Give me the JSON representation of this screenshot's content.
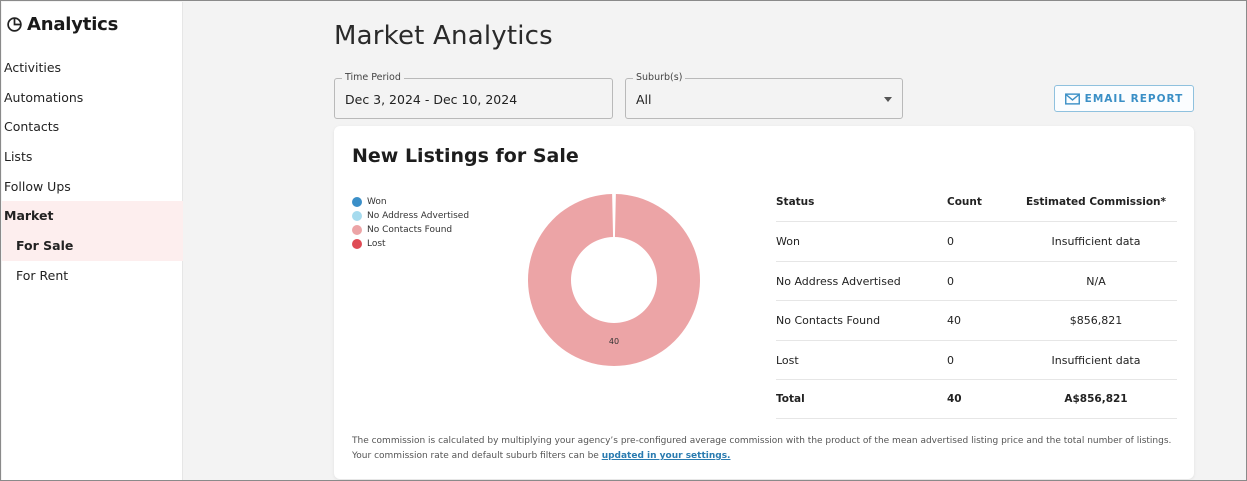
{
  "app": {
    "title": "Analytics"
  },
  "sidebar": {
    "items": [
      {
        "label": "Activities"
      },
      {
        "label": "Automations"
      },
      {
        "label": "Contacts"
      },
      {
        "label": "Lists"
      },
      {
        "label": "Follow Ups"
      },
      {
        "label": "Market"
      }
    ],
    "subitems": [
      {
        "label": "For Sale"
      },
      {
        "label": "For Rent"
      }
    ]
  },
  "main": {
    "title": "Market Analytics",
    "time_period": {
      "legend": "Time Period",
      "value": "Dec 3, 2024 - Dec 10, 2024"
    },
    "suburbs": {
      "legend": "Suburb(s)",
      "value": "All"
    },
    "email_button": "EMAIL REPORT"
  },
  "card": {
    "title": "New Listings for Sale",
    "legend": [
      {
        "label": "Won",
        "color": "#3b8fc8"
      },
      {
        "label": "No Address Advertised",
        "color": "#a6dbee"
      },
      {
        "label": "No Contacts Found",
        "color": "#eca4a6"
      },
      {
        "label": "Lost",
        "color": "#df4b55"
      }
    ],
    "table": {
      "headers": [
        "Status",
        "Count",
        "Estimated Commission*"
      ],
      "rows": [
        [
          "Won",
          "0",
          "Insufficient data"
        ],
        [
          "No Address Advertised",
          "0",
          "N/A"
        ],
        [
          "No Contacts Found",
          "40",
          "$856,821"
        ],
        [
          "Lost",
          "0",
          "Insufficient data"
        ]
      ],
      "total": [
        "Total",
        "40",
        "A$856,821"
      ]
    },
    "footnote_line1": "The commission is calculated by multiplying your agency’s pre-configured average commission with the product of the mean advertised listing price and the total number of listings.",
    "footnote_line2_prefix": "Your commission rate and default suburb filters can be ",
    "footnote_link": "updated in your settings."
  },
  "chart_data": {
    "type": "pie",
    "categories": [
      "Won",
      "No Address Advertised",
      "No Contacts Found",
      "Lost"
    ],
    "values": [
      0,
      0,
      40,
      0
    ],
    "data_labels": [
      "",
      "",
      "40",
      ""
    ]
  }
}
